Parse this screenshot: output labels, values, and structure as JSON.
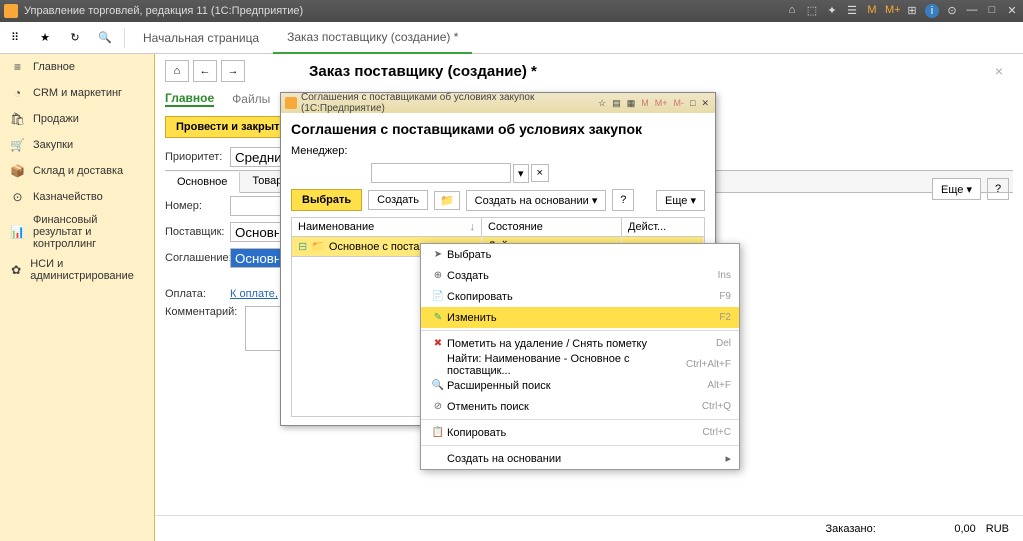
{
  "title_bar": {
    "app_title": "Управление торговлей, редакция 11 (1С:Предприятие)"
  },
  "top_tabs": {
    "start": "Начальная страница",
    "doc": "Заказ поставщику (создание) *"
  },
  "sidebar": {
    "items": [
      {
        "icon": "≡",
        "label": "Главное"
      },
      {
        "icon": "◔",
        "label": "CRM и маркетинг"
      },
      {
        "icon": "🛍",
        "label": "Продажи"
      },
      {
        "icon": "🛒",
        "label": "Закупки"
      },
      {
        "icon": "📦",
        "label": "Склад и доставка"
      },
      {
        "icon": "⊙",
        "label": "Казначейство"
      },
      {
        "icon": "📊",
        "label": "Финансовый результат и контроллинг"
      },
      {
        "icon": "✿",
        "label": "НСИ и администрирование"
      }
    ]
  },
  "doc": {
    "title": "Заказ поставщику (создание) *",
    "tab_main": "Главное",
    "tab_files": "Файлы",
    "btn_save": "Провести и закрыть",
    "btn_more": "Еще ▾",
    "priority_label": "Приоритет:",
    "priority_value": "Средний",
    "inner_tab_main": "Основное",
    "inner_tab_goods": "Товары",
    "number_label": "Номер:",
    "supplier_label": "Поставщик:",
    "supplier_value": "Основной",
    "agreement_label": "Соглашение:",
    "agreement_value": "Основное",
    "payment_label": "Оплата:",
    "payment_link": "К оплате,",
    "comment_label": "Комментарий:"
  },
  "dialog": {
    "window_title": "Соглашения с поставщиками об условиях закупок (1С:Предприятие)",
    "heading": "Соглашения с поставщиками об условиях закупок",
    "manager_label": "Менеджер:",
    "btn_select": "Выбрать",
    "btn_create": "Создать",
    "btn_based_on": "Создать на основании ▾",
    "btn_more": "Еще ▾",
    "col_name": "Наименование",
    "col_state": "Состояние",
    "col_valid": "Дейст...",
    "row_name": "Основное с поставщиком",
    "row_state": "Действует"
  },
  "ctx_menu": {
    "items": [
      {
        "icon": "➤",
        "label": "Выбрать",
        "shortcut": ""
      },
      {
        "icon": "⊕",
        "label": "Создать",
        "shortcut": "Ins"
      },
      {
        "icon": "📄",
        "label": "Скопировать",
        "shortcut": "F9"
      },
      {
        "icon": "✎",
        "label": "Изменить",
        "shortcut": "F2",
        "highlighted": true
      },
      {
        "sep": true
      },
      {
        "icon": "✖",
        "label": "Пометить на удаление / Снять пометку",
        "shortcut": "Del"
      },
      {
        "icon": "",
        "label": "Найти: Наименование - Основное с поставщик...",
        "shortcut": "Ctrl+Alt+F"
      },
      {
        "icon": "🔍",
        "label": "Расширенный поиск",
        "shortcut": "Alt+F"
      },
      {
        "icon": "⊘",
        "label": "Отменить поиск",
        "shortcut": "Ctrl+Q"
      },
      {
        "sep": true
      },
      {
        "icon": "📋",
        "label": "Копировать",
        "shortcut": "Ctrl+C"
      },
      {
        "sep": true
      },
      {
        "icon": "",
        "label": "Создать на основании",
        "shortcut": "",
        "submenu": true
      }
    ]
  },
  "footer": {
    "ordered_label": "Заказано:",
    "ordered_value": "0,00",
    "currency": "RUB"
  }
}
